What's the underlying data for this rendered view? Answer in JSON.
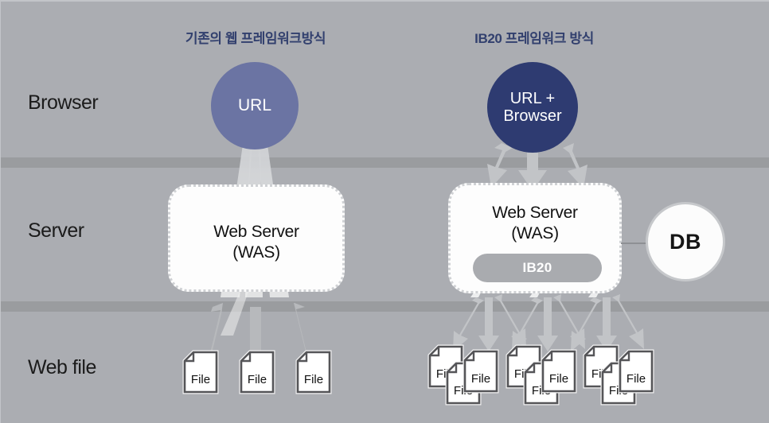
{
  "diagram": {
    "background_color": "#abadb2",
    "band_color": "#9a9c9f",
    "title_color": "#32406e",
    "columns": [
      {
        "key": "legacy",
        "title": "기존의 웹 프레임워크방식"
      },
      {
        "key": "ib20",
        "title": "IB20 프레임워크 방식"
      }
    ],
    "lanes": [
      {
        "key": "browser",
        "label": "Browser"
      },
      {
        "key": "server",
        "label": "Server"
      },
      {
        "key": "web_file",
        "label": "Web file"
      }
    ],
    "nodes": {
      "url_circle": {
        "label": "URL",
        "color": "#6b74a3"
      },
      "url_browser_circle": {
        "line1": "URL +",
        "line2": "Browser",
        "color": "#2e3b71"
      },
      "web_server_left": {
        "line1": "Web Server",
        "line2": "(WAS)"
      },
      "web_server_right": {
        "line1": "Web Server",
        "line2": "(WAS)"
      },
      "ib20_module": {
        "label": "IB20",
        "color": "#a9abaf"
      },
      "database": {
        "label": "DB"
      }
    },
    "files": {
      "item_label": "File",
      "left_count": 3,
      "right_group_count": 3,
      "right_files_per_group": 3
    },
    "flows": {
      "legacy_browser_to_server": {
        "style": "beam",
        "count": 3
      },
      "legacy_server_to_files": {
        "style": "arrow",
        "count": 3
      },
      "ib20_browser_to_server": {
        "style": "arrow",
        "count": 3
      },
      "ib20_server_to_files": {
        "style": "arrow",
        "count": 9
      }
    }
  }
}
